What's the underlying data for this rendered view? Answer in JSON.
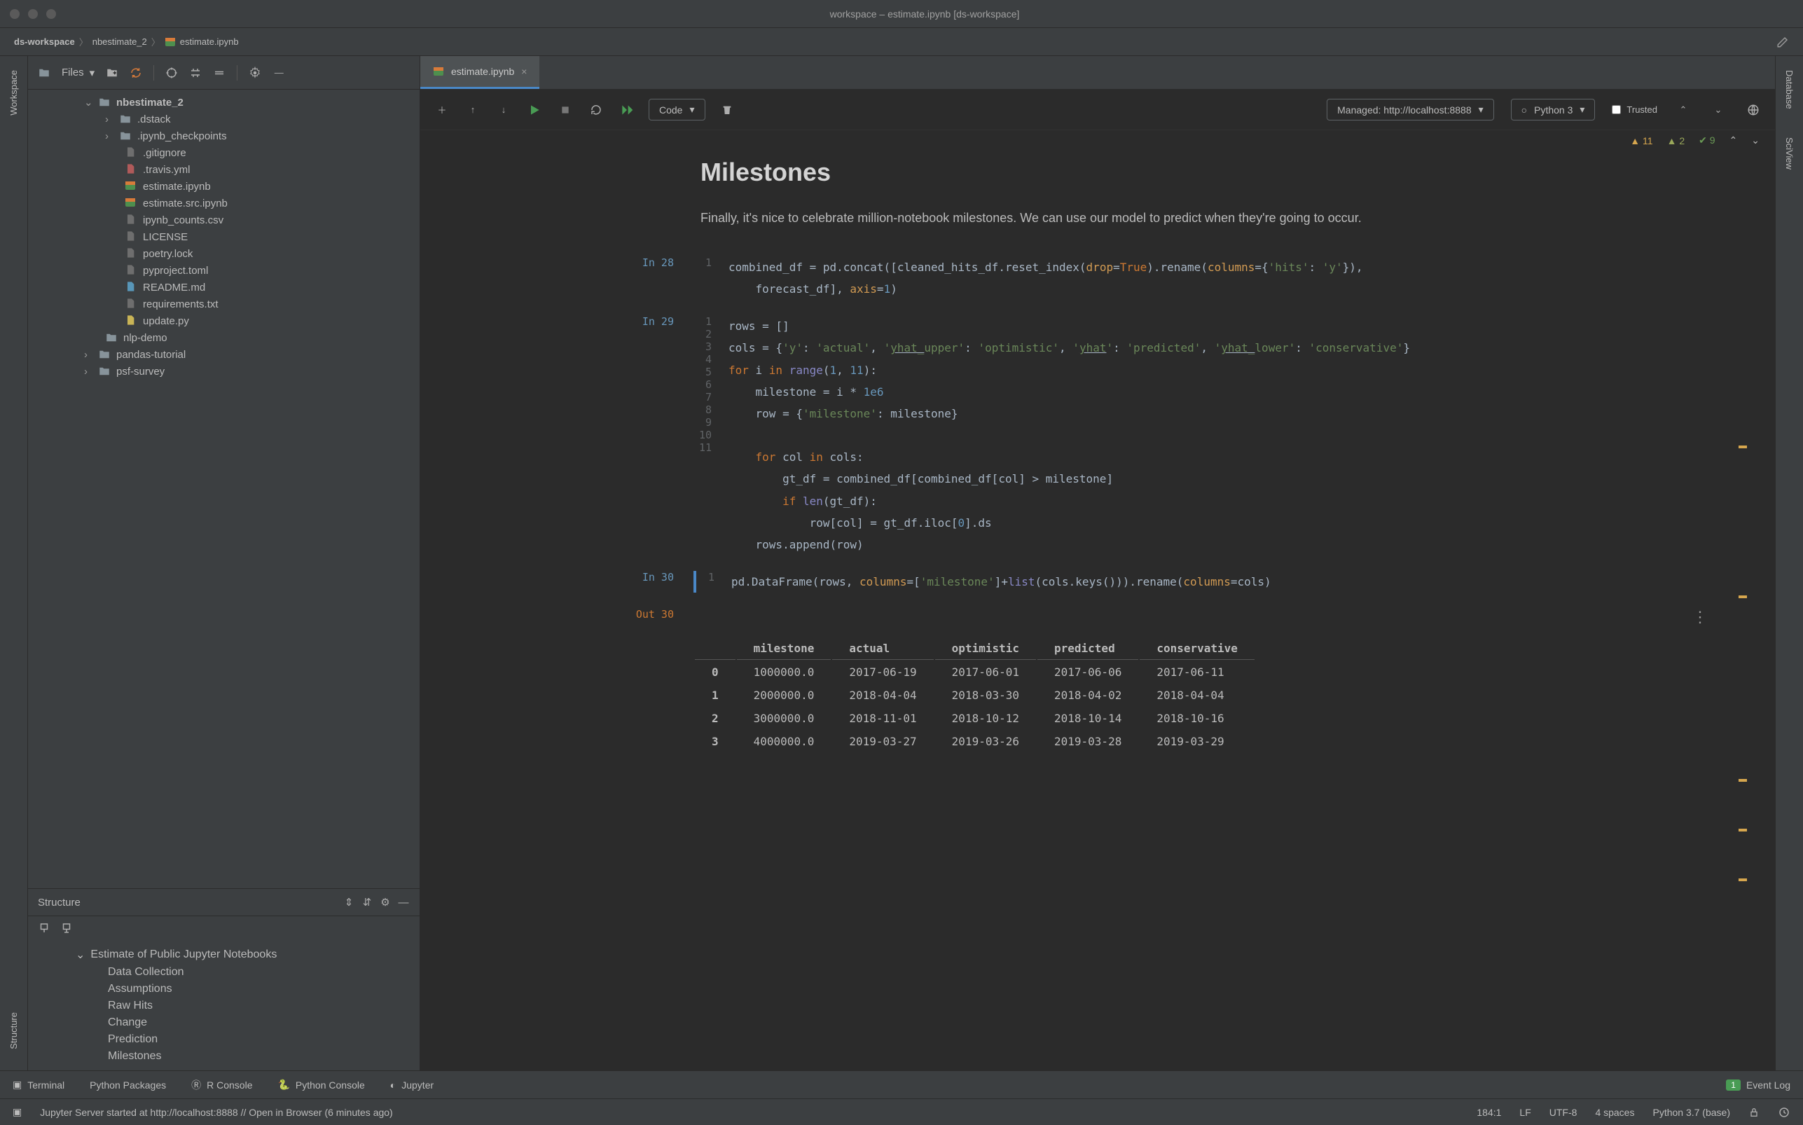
{
  "window": {
    "title": "workspace – estimate.ipynb [ds-workspace]"
  },
  "breadcrumbs": [
    "ds-workspace",
    "nbestimate_2",
    "estimate.ipynb"
  ],
  "sidebar_left_label": "Workspace",
  "sidebar_left_label2": "Structure",
  "sidebar_right_label1": "Database",
  "sidebar_right_label2": "SciView",
  "files_panel": {
    "dropdown": "Files",
    "tree": {
      "root": "nbestimate_2",
      "folders": [
        ".dstack",
        ".ipynb_checkpoints"
      ],
      "files": [
        ".gitignore",
        ".travis.yml",
        "estimate.ipynb",
        "estimate.src.ipynb",
        "ipynb_counts.csv",
        "LICENSE",
        "poetry.lock",
        "pyproject.toml",
        "README.md",
        "requirements.txt",
        "update.py"
      ],
      "siblings": [
        "nlp-demo",
        "pandas-tutorial",
        "psf-survey"
      ]
    }
  },
  "structure_panel": {
    "title": "Structure",
    "root": "Estimate of Public Jupyter Notebooks",
    "items": [
      "Data Collection",
      "Assumptions",
      "Raw Hits",
      "Change",
      "Prediction",
      "Milestones"
    ]
  },
  "tab": {
    "name": "estimate.ipynb"
  },
  "notebook_toolbar": {
    "cell_type": "Code",
    "managed": "Managed: http://localhost:8888",
    "kernel": "Python 3",
    "trusted": "Trusted"
  },
  "inspection_counts": {
    "warn": "11",
    "weak": "2",
    "ok": "9"
  },
  "heading": "Milestones",
  "paragraph": "Finally, it's nice to celebrate million-notebook milestones. We can use our model to predict when they're going to occur.",
  "cells": {
    "c28": {
      "label": "In 28",
      "lines": [
        "combined_df = pd.concat([cleaned_hits_df.reset_index(drop=True).rename(columns={'hits': 'y'}),",
        "    forecast_df], axis=1)"
      ]
    },
    "c29": {
      "label": "In 29"
    },
    "c30": {
      "label": "In 30"
    },
    "out30": {
      "label": "Out 30"
    }
  },
  "output_table": {
    "headers": [
      "",
      "milestone",
      "actual",
      "optimistic",
      "predicted",
      "conservative"
    ],
    "rows": [
      [
        "0",
        "1000000.0",
        "2017-06-19",
        "2017-06-01",
        "2017-06-06",
        "2017-06-11"
      ],
      [
        "1",
        "2000000.0",
        "2018-04-04",
        "2018-03-30",
        "2018-04-02",
        "2018-04-04"
      ],
      [
        "2",
        "3000000.0",
        "2018-11-01",
        "2018-10-12",
        "2018-10-14",
        "2018-10-16"
      ],
      [
        "3",
        "4000000.0",
        "2019-03-27",
        "2019-03-26",
        "2019-03-28",
        "2019-03-29"
      ]
    ]
  },
  "bottom_tabs": [
    "Terminal",
    "Python Packages",
    "R Console",
    "Python Console",
    "Jupyter"
  ],
  "event_log": {
    "count": "1",
    "label": "Event Log"
  },
  "status": {
    "message": "Jupyter Server started at http://localhost:8888 // Open in Browser (6 minutes ago)",
    "pos": "184:1",
    "lf": "LF",
    "enc": "UTF-8",
    "spaces": "4 spaces",
    "interpreter": "Python 3.7 (base)"
  }
}
